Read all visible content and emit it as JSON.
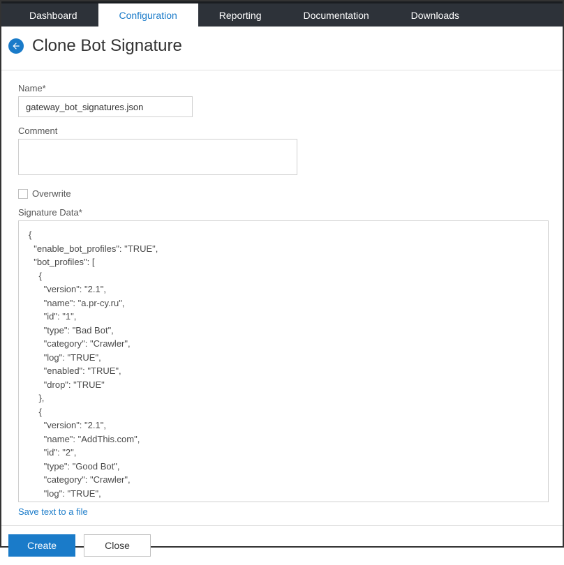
{
  "nav": {
    "items": [
      {
        "label": "Dashboard",
        "active": false
      },
      {
        "label": "Configuration",
        "active": true
      },
      {
        "label": "Reporting",
        "active": false
      },
      {
        "label": "Documentation",
        "active": false
      },
      {
        "label": "Downloads",
        "active": false
      }
    ]
  },
  "header": {
    "title": "Clone Bot Signature"
  },
  "form": {
    "name_label": "Name*",
    "name_value": "gateway_bot_signatures.json",
    "comment_label": "Comment",
    "comment_value": "",
    "overwrite_label": "Overwrite",
    "overwrite_checked": false,
    "sig_label": "Signature Data*",
    "signature_data": "{\n  \"enable_bot_profiles\": \"TRUE\",\n  \"bot_profiles\": [\n    {\n      \"version\": \"2.1\",\n      \"name\": \"a.pr-cy.ru\",\n      \"id\": \"1\",\n      \"type\": \"Bad Bot\",\n      \"category\": \"Crawler\",\n      \"log\": \"TRUE\",\n      \"enabled\": \"TRUE\",\n      \"drop\": \"TRUE\"\n    },\n    {\n      \"version\": \"2.1\",\n      \"name\": \"AddThis.com\",\n      \"id\": \"2\",\n      \"type\": \"Good Bot\",\n      \"category\": \"Crawler\",\n      \"log\": \"TRUE\",\n      \"enabled\": \"TRUE\",\n      \"drop\": \"FALSE\"",
    "save_link": "Save text to a file"
  },
  "footer": {
    "create_label": "Create",
    "close_label": "Close"
  }
}
